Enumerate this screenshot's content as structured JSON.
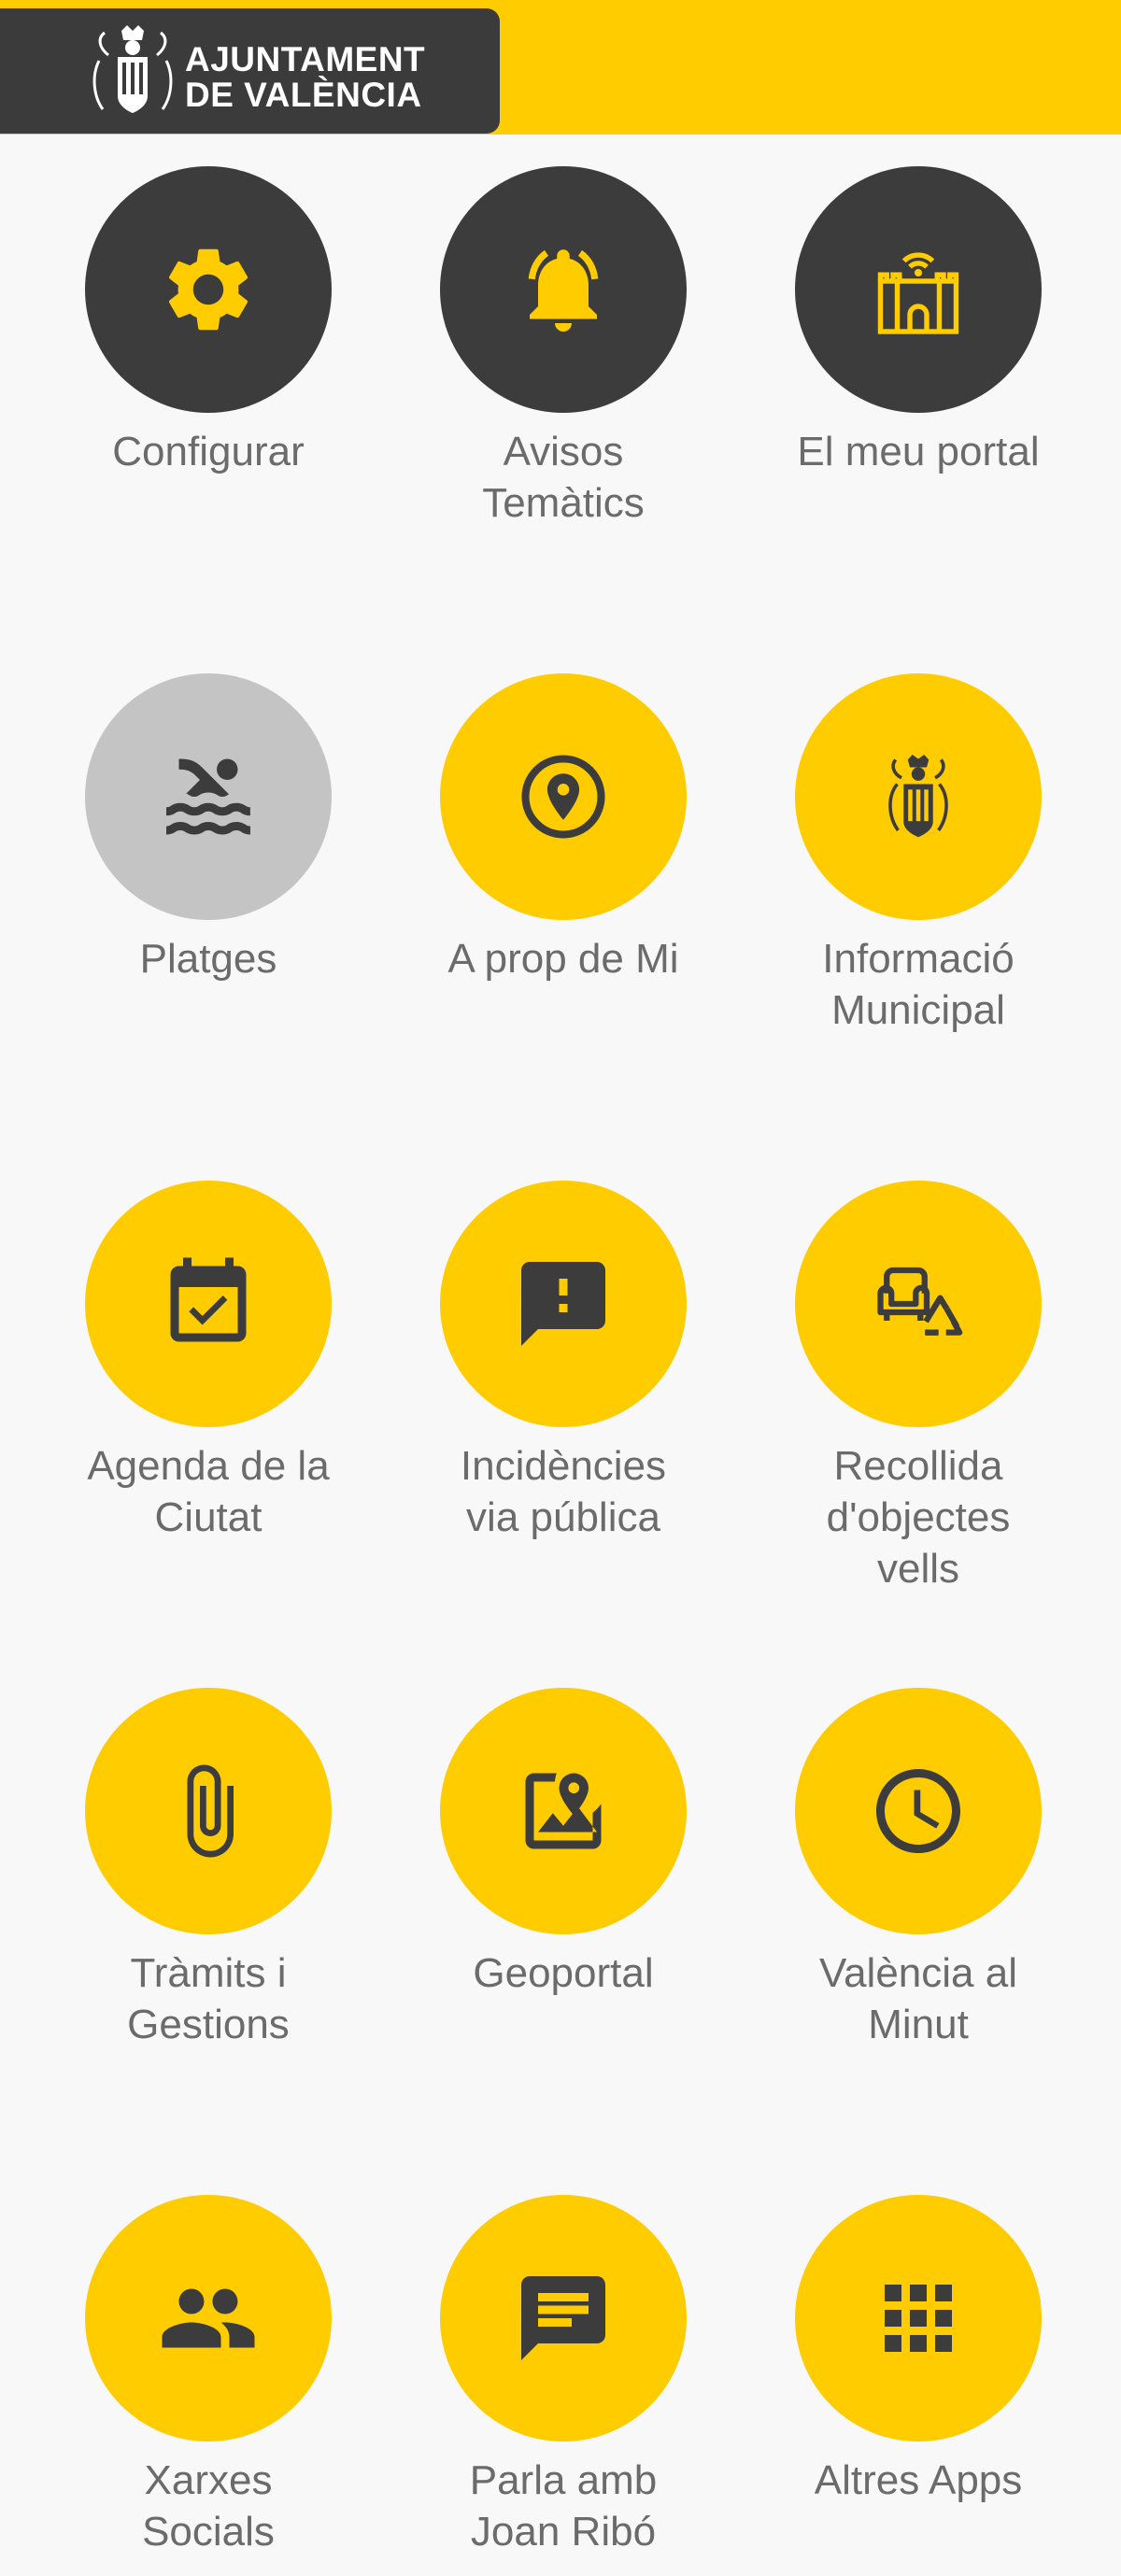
{
  "header": {
    "logo_line1": "AJUNTAMENT",
    "logo_line2": "DE VALÈNCIA",
    "background_color": "#ffcc00",
    "logo_background_color": "#3b3b3b"
  },
  "colors": {
    "accent": "#ffcc00",
    "dark": "#3c3c3c",
    "disabled": "#c4c4c4",
    "label": "#6b6b6b"
  },
  "menu": {
    "configurar": {
      "label": "Configurar",
      "icon": "gear-icon"
    },
    "avisos": {
      "label": "Avisos\nTemàtics",
      "icon": "bell-icon"
    },
    "portal": {
      "label": "El meu portal",
      "icon": "portal-tower-wifi-icon"
    },
    "platges": {
      "label": "Platges",
      "icon": "swimmer-icon"
    },
    "aprop": {
      "label": "A prop de Mi",
      "icon": "location-pin-icon"
    },
    "informacio": {
      "label": "Informació\nMunicipal",
      "icon": "city-crest-icon"
    },
    "agenda": {
      "label": "Agenda de la\nCiutat",
      "icon": "calendar-check-icon"
    },
    "incidencies": {
      "label": "Incidències\nvia pública",
      "icon": "report-bubble-icon"
    },
    "recollida": {
      "label": "Recollida\nd'objectes\nvells",
      "icon": "armchair-recycle-icon"
    },
    "tramits": {
      "label": "Tràmits i\nGestions",
      "icon": "paperclip-icon"
    },
    "geoportal": {
      "label": "Geoportal",
      "icon": "map-pin-icon"
    },
    "minut": {
      "label": "València al\nMinut",
      "icon": "clock-icon"
    },
    "xarxes": {
      "label": "Xarxes\nSocials",
      "icon": "people-icon"
    },
    "parla": {
      "label": "Parla amb\nJoan Ribó",
      "icon": "chat-icon"
    },
    "altres": {
      "label": "Altres Apps",
      "icon": "apps-grid-icon"
    }
  }
}
